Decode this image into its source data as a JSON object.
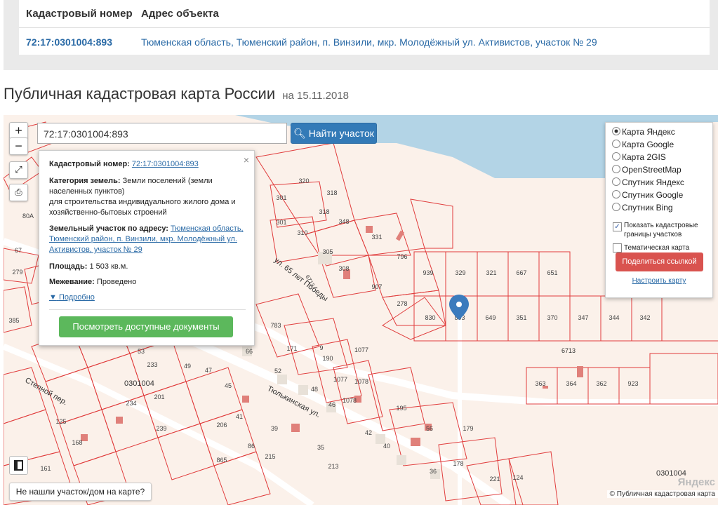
{
  "table": {
    "header_cad": "Кадастровый номер",
    "header_addr": "Адрес объекта",
    "cad_value": "72:17:0301004:893",
    "addr_value": "Тюменская область, Тюменский район, п. Винзили, мкр. Молодёжный ул. Активистов, участок № 29"
  },
  "page": {
    "title": "Публичная кадастровая карта России",
    "date": "на 15.11.2018"
  },
  "map": {
    "zoom_in": "+",
    "zoom_out": "−",
    "search_value": "72:17:0301004:893",
    "find_button": "Найти участок",
    "not_found": "Не нашли участок/дом на карте?",
    "copyright": "© Публичная кадастровая карта",
    "yandex": "Яндекс",
    "street_labels": [
      "ул. 65 лет Победы",
      "Тюлькинская ул.",
      "Степной пер."
    ],
    "block_labels": [
      "0301004",
      "0301004",
      "6713",
      "6713"
    ],
    "parcel_labels": [
      "320",
      "318",
      "301",
      "318",
      "301",
      "310",
      "348",
      "331",
      "305",
      "308",
      "796",
      "939",
      "329",
      "321",
      "667",
      "651",
      "907",
      "278",
      "830",
      "893",
      "649",
      "351",
      "370",
      "347",
      "344",
      "342",
      "363",
      "364",
      "362",
      "923",
      "783",
      "171",
      "9",
      "1077",
      "190",
      "1077",
      "1078",
      "1078",
      "195",
      "179",
      "178",
      "56",
      "48",
      "46",
      "42",
      "40",
      "39",
      "35",
      "36",
      "221",
      "124",
      "233",
      "234",
      "125",
      "168",
      "201",
      "239",
      "206",
      "865",
      "86",
      "215",
      "213",
      "66",
      "52",
      "45",
      "47",
      "49",
      "53",
      "41",
      "80А",
      "67",
      "279",
      "385",
      "161"
    ]
  },
  "popup": {
    "cad_label": "Кадастровый номер:",
    "cad_link": "72:17:0301004:893",
    "cat_label": "Категория земель:",
    "cat_value": "Земли поселений (земли населенных пунктов)",
    "use_value": "для строительства индивидуального жилого дома и хозяйственно-бытовых строений",
    "addr_label": "Земельный участок по адресу:",
    "addr_link": "Тюменская область, Тюменский район, п. Винзили, мкр. Молодёжный ул. Активистов, участок № 29",
    "area_label": "Площадь:",
    "area_value": "1 503 кв.м.",
    "survey_label": "Межевание:",
    "survey_value": "Проведено",
    "more": "Подробно",
    "docs_button": "Посмотреть доступные документы",
    "close": "×"
  },
  "layers": {
    "options": [
      {
        "label": "Карта Яндекс",
        "selected": true
      },
      {
        "label": "Карта Google",
        "selected": false
      },
      {
        "label": "Карта 2GIS",
        "selected": false
      },
      {
        "label": "OpenStreetMap",
        "selected": false
      },
      {
        "label": "Спутник Яндекс",
        "selected": false
      },
      {
        "label": "Спутник Google",
        "selected": false
      },
      {
        "label": "Спутник Bing",
        "selected": false
      }
    ],
    "show_borders": "Показать кадастровые границы участков",
    "show_borders_checked": true,
    "thematic": "Тематическая карта",
    "thematic_checked": false,
    "share_button": "Поделиться ссылкой",
    "configure": "Настроить карту"
  },
  "colors": {
    "link": "#2a6aa6",
    "find_button": "#337ab7",
    "docs_button": "#5cb85c",
    "share_button": "#d9534f",
    "parcel_border": "#e03c3c",
    "water": "#b3d4e6",
    "marker": "#3b7bbd"
  }
}
